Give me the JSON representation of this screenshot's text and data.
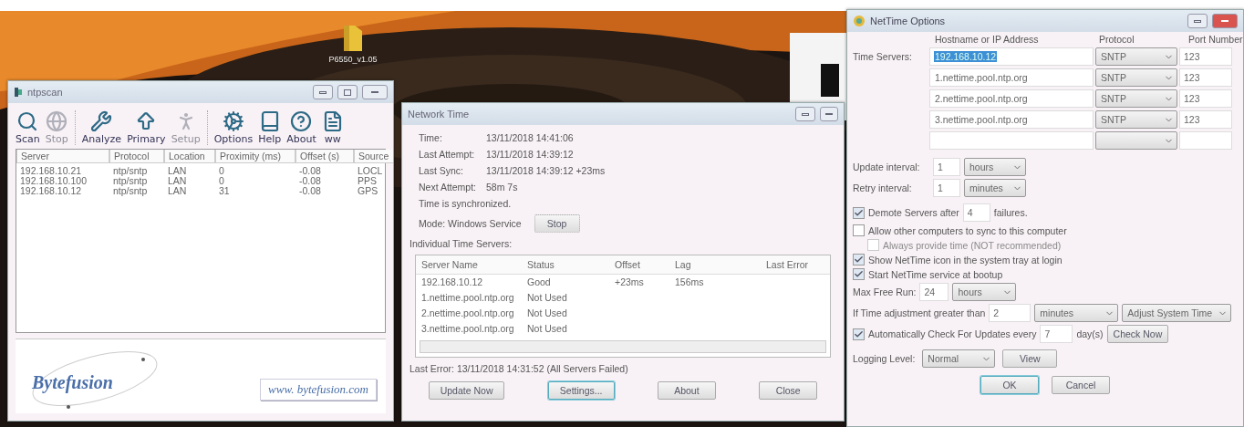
{
  "desktop": {
    "icons": [
      {
        "label": "P6550_v1.05"
      }
    ]
  },
  "ntpscan": {
    "title": "ntpscan",
    "toolbar_groups": [
      [
        {
          "label": "Scan",
          "disabled": false
        },
        {
          "label": "Stop",
          "disabled": true
        }
      ],
      [
        {
          "label": "Analyze",
          "disabled": false
        },
        {
          "label": "Primary",
          "disabled": false
        },
        {
          "label": "Setup",
          "disabled": true
        }
      ],
      [
        {
          "label": "Options",
          "disabled": false
        },
        {
          "label": "Help",
          "disabled": false
        },
        {
          "label": "About",
          "disabled": false
        },
        {
          "label": "ww",
          "disabled": false
        }
      ]
    ],
    "columns": [
      "Server",
      "Protocol",
      "Location",
      "Proximity (ms)",
      "Offset (s)",
      "Source"
    ],
    "rows": [
      [
        "192.168.10.21",
        "ntp/sntp",
        "LAN",
        "0",
        "-0.08",
        "LOCL"
      ],
      [
        "192.168.10.100",
        "ntp/sntp",
        "LAN",
        "0",
        "-0.08",
        "PPS"
      ],
      [
        "192.168.10.12",
        "ntp/sntp",
        "LAN",
        "31",
        "-0.08",
        "GPS"
      ]
    ],
    "logo": "Bytefusion",
    "link": "www. bytefusion.com"
  },
  "network_time": {
    "title": "Network Time",
    "fields": [
      {
        "label": "Time:",
        "value": "13/11/2018 14:41:06"
      },
      {
        "label": "Last Attempt:",
        "value": "13/11/2018 14:39:12"
      },
      {
        "label": "Last Sync:",
        "value": "13/11/2018 14:39:12 +23ms"
      },
      {
        "label": "Next Attempt:",
        "value": "58m 7s"
      }
    ],
    "status": "Time is synchronized.",
    "mode": "Mode: Windows Service",
    "mode_button": "Stop",
    "servers_heading": "Individual Time Servers:",
    "columns": [
      "Server Name",
      "Status",
      "Offset",
      "Lag",
      "Last Error"
    ],
    "rows": [
      [
        "192.168.10.12",
        "Good",
        "+23ms",
        "156ms",
        ""
      ],
      [
        "1.nettime.pool.ntp.org",
        "Not Used",
        "",
        "",
        ""
      ],
      [
        "2.nettime.pool.ntp.org",
        "Not Used",
        "",
        "",
        ""
      ],
      [
        "3.nettime.pool.ntp.org",
        "Not Used",
        "",
        "",
        ""
      ]
    ],
    "last_error": "Last Error: 13/11/2018 14:31:52 (All Servers Failed)",
    "buttons": [
      {
        "label": "Update Now",
        "focused": false
      },
      {
        "label": "Settings...",
        "focused": true
      },
      {
        "label": "About",
        "focused": false
      },
      {
        "label": "Close",
        "focused": false
      }
    ]
  },
  "options": {
    "title": "NetTime Options",
    "headers": [
      "Hostname or IP Address",
      "Protocol",
      "Port Number"
    ],
    "time_servers_label": "Time Servers:",
    "servers": [
      {
        "kind": "server",
        "host": "192.168.10.12",
        "protocol": "SNTP",
        "port": "123",
        "selected": true
      },
      {
        "kind": "server",
        "host": "1.nettime.pool.ntp.org",
        "protocol": "SNTP",
        "port": "123",
        "selected": false
      },
      {
        "kind": "server",
        "host": "2.nettime.pool.ntp.org",
        "protocol": "SNTP",
        "port": "123",
        "selected": false
      },
      {
        "kind": "server",
        "host": "3.nettime.pool.ntp.org",
        "protocol": "SNTP",
        "port": "123",
        "selected": false
      },
      {
        "kind": "blank"
      }
    ],
    "update_interval": {
      "label": "Update interval:",
      "value": "1",
      "unit": "hours"
    },
    "retry_interval": {
      "label": "Retry interval:",
      "value": "1",
      "unit": "minutes"
    },
    "demote": {
      "checked": true,
      "label": "Demote Servers after",
      "value": "4",
      "suffix": "failures."
    },
    "allow_sync": {
      "checked": false,
      "label": "Allow other computers to sync to this computer"
    },
    "always_provide": {
      "checked": false,
      "disabled": true,
      "label": "Always provide time (NOT recommended)"
    },
    "show_icon": {
      "checked": true,
      "label": "Show NetTime icon in the system tray at login"
    },
    "start_service": {
      "checked": true,
      "label": "Start NetTime service at bootup"
    },
    "max_free_run": {
      "label": "Max Free Run:",
      "value": "24",
      "unit": "hours"
    },
    "adjust": {
      "label": "If Time adjustment greater than",
      "value": "2",
      "unit": "minutes",
      "action": "Adjust System Time"
    },
    "auto_update": {
      "checked": true,
      "label": "Automatically Check For Updates every",
      "value": "7",
      "suffix": "day(s)",
      "button": "Check Now"
    },
    "logging": {
      "label": "Logging Level:",
      "value": "Normal",
      "button": "View"
    },
    "buttons": [
      {
        "label": "OK",
        "focused": true
      },
      {
        "label": "Cancel",
        "focused": false
      }
    ]
  }
}
